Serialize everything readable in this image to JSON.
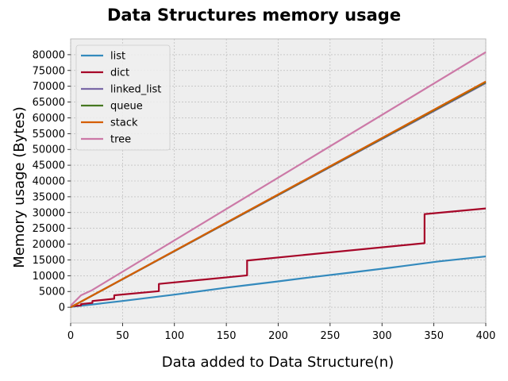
{
  "chart_data": {
    "type": "line",
    "title": "Data Structures memory usage",
    "xlabel": "Data added to Data Structure(n)",
    "ylabel": "Memory usage (Bytes)",
    "xlim": [
      0,
      400
    ],
    "ylim": [
      -5000,
      85000
    ],
    "xticks": [
      0,
      50,
      100,
      150,
      200,
      250,
      300,
      350,
      400
    ],
    "yticks": [
      0,
      5000,
      10000,
      15000,
      20000,
      25000,
      30000,
      35000,
      40000,
      45000,
      50000,
      55000,
      60000,
      65000,
      70000,
      75000,
      80000
    ],
    "grid": true,
    "legend_position": "top-left",
    "background": "#eeeeee",
    "series": [
      {
        "name": "list",
        "color": "#348abd",
        "points": [
          [
            0,
            100
          ],
          [
            50,
            2000
          ],
          [
            100,
            4000
          ],
          [
            150,
            6200
          ],
          [
            170,
            7000
          ],
          [
            200,
            8200
          ],
          [
            234,
            9600
          ],
          [
            270,
            11000
          ],
          [
            310,
            12600
          ],
          [
            354,
            14500
          ],
          [
            400,
            16100
          ]
        ]
      },
      {
        "name": "dict",
        "color": "#a60628",
        "points": [
          [
            0,
            300
          ],
          [
            10,
            600
          ],
          [
            10.01,
            1000
          ],
          [
            21,
            1400
          ],
          [
            21.01,
            2000
          ],
          [
            42,
            2700
          ],
          [
            42.01,
            3800
          ],
          [
            85,
            5100
          ],
          [
            85.01,
            7400
          ],
          [
            170,
            10100
          ],
          [
            170.01,
            14800
          ],
          [
            341,
            20300
          ],
          [
            341.01,
            29500
          ],
          [
            400,
            31300
          ]
        ]
      },
      {
        "name": "linked_list",
        "color": "#7a68a6",
        "points": [
          [
            0,
            0
          ],
          [
            400,
            71000
          ]
        ]
      },
      {
        "name": "queue",
        "color": "#467821",
        "points": [
          [
            0,
            0
          ],
          [
            400,
            71300
          ]
        ]
      },
      {
        "name": "stack",
        "color": "#d55e00",
        "points": [
          [
            0,
            0
          ],
          [
            400,
            71500
          ]
        ]
      },
      {
        "name": "tree",
        "color": "#cc79a7",
        "points": [
          [
            0,
            500
          ],
          [
            10,
            3800
          ],
          [
            20,
            5300
          ],
          [
            400,
            80800
          ]
        ]
      }
    ]
  }
}
